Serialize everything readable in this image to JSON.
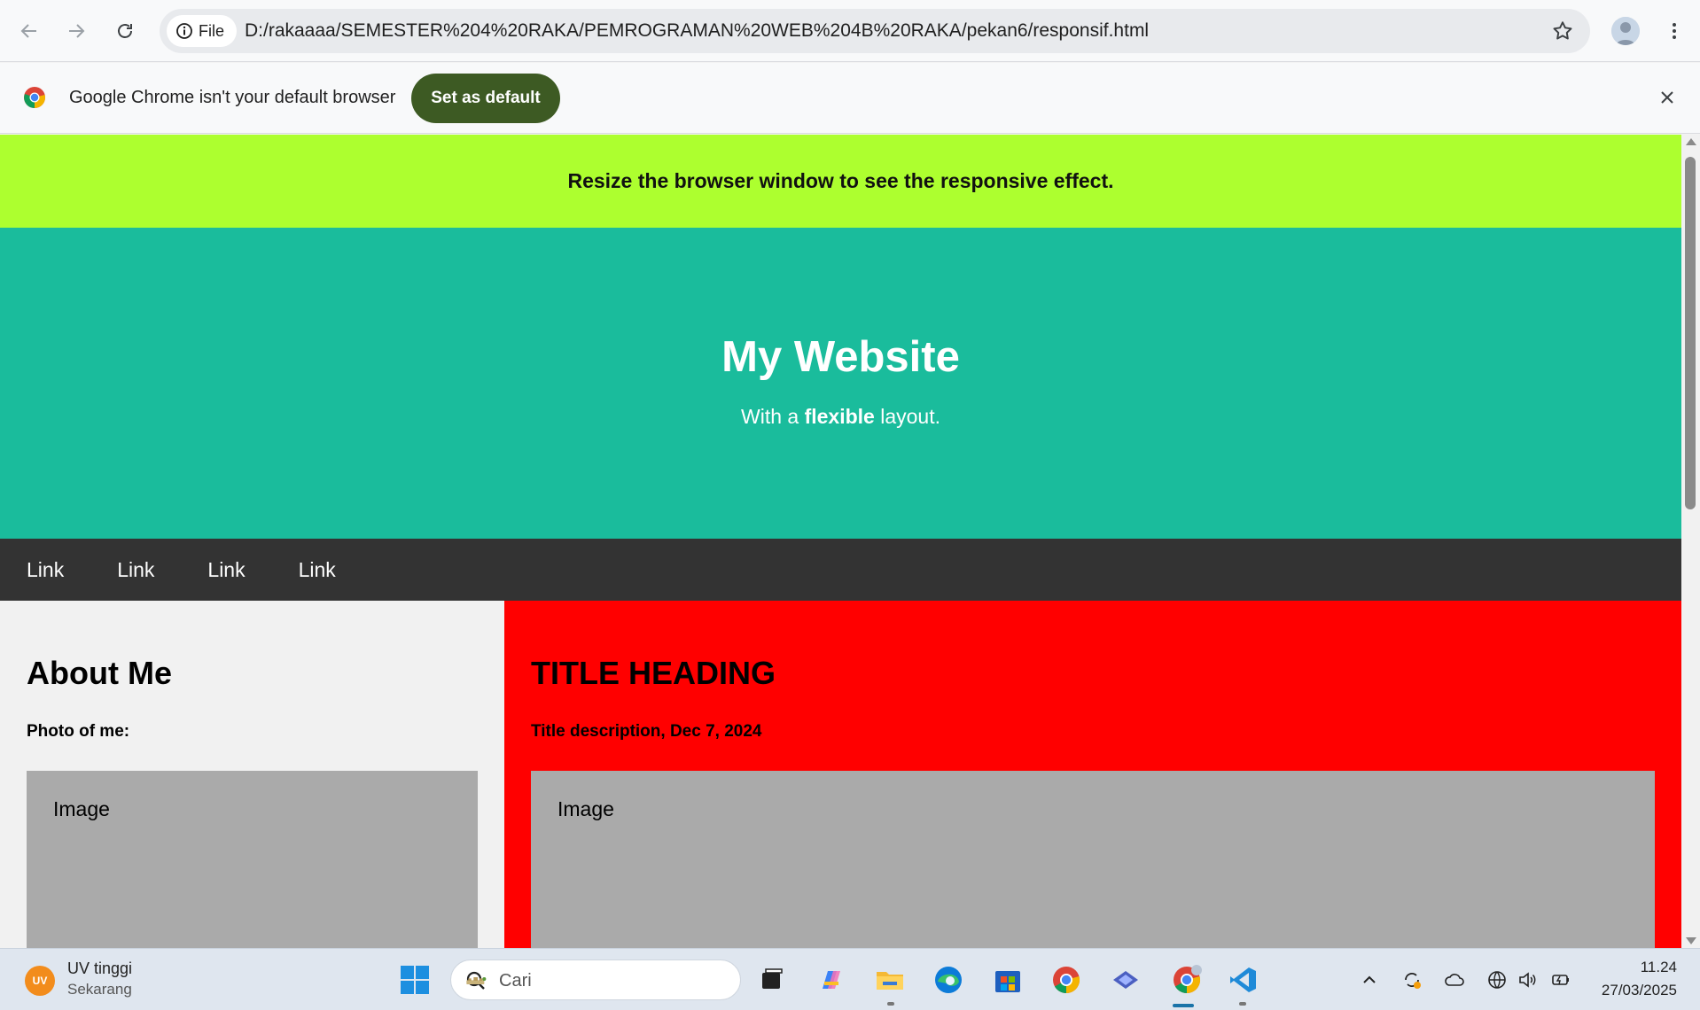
{
  "browser": {
    "origin_chip": "File",
    "url": "D:/rakaaaa/SEMESTER%204%20RAKA/PEMROGRAMAN%20WEB%204B%20RAKA/pekan6/responsif.html"
  },
  "infobar": {
    "message": "Google Chrome isn't your default browser",
    "set_default_label": "Set as default"
  },
  "page": {
    "notice": "Resize the browser window to see the responsive effect.",
    "title": "My Website",
    "subtitle_pre": "With a ",
    "subtitle_bold": "flexible",
    "subtitle_post": " layout.",
    "nav": [
      "Link",
      "Link",
      "Link",
      "Link"
    ],
    "side": {
      "heading": "About Me",
      "subheading": "Photo of me:",
      "image_label": "Image"
    },
    "main": {
      "heading": "TITLE HEADING",
      "subheading": "Title description, Dec 7, 2024",
      "image_label": "Image"
    }
  },
  "taskbar": {
    "weather_badge": "UV",
    "weather_title": "UV tinggi",
    "weather_sub": "Sekarang",
    "search_placeholder": "Cari",
    "time": "11.24",
    "date": "27/03/2025"
  },
  "colors": {
    "notice_bg": "#adff2f",
    "header_bg": "#1abc9c",
    "nav_bg": "#333333",
    "main_bg": "#ff0000",
    "side_bg": "#f1f1f1",
    "image_bg": "#aaaaaa",
    "set_default_bg": "#3d5a23"
  }
}
